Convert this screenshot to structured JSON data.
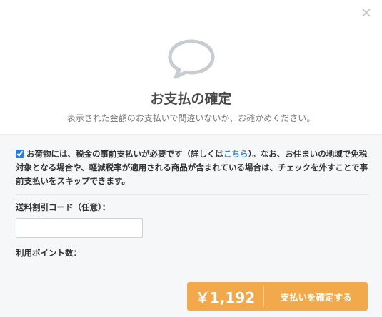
{
  "dialog": {
    "close_icon": "close-icon",
    "illustration_icon": "speech-bubble-icon",
    "title": "お支払の確定",
    "subtitle": "表示された金額のお支払いで間違いないか、お確かめください。"
  },
  "notice": {
    "checked": true,
    "text_before": "お荷物には、税金の事前支払いが必要です（詳しくは",
    "link": "こちら",
    "text_after": "）。なお、お住まいの地域で免税対象となる場合や、軽減税率が適用される商品が含まれている場合は、チェックを外すことで事前支払いをスキップできます。"
  },
  "form": {
    "code_label": "送料割引コード（任意）：",
    "code_value": "",
    "points_label": "利用ポイント数："
  },
  "pay_button": {
    "amount": "￥1,192",
    "label": "支払いを確定する",
    "color": "#f1a94b"
  }
}
